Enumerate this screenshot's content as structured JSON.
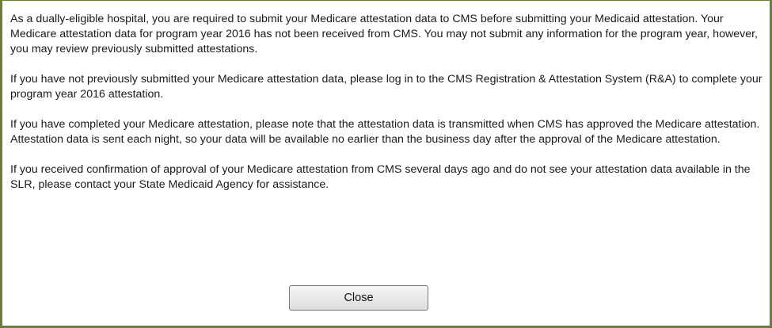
{
  "dialog": {
    "paragraphs": [
      "As a dually-eligible hospital, you are required to submit your Medicare attestation data to CMS before submitting your Medicaid attestation. Your Medicare attestation data for program year 2016 has not been received from CMS. You may not submit any information for the program year, however, you may review previously submitted attestations.",
      "If you have not previously submitted your Medicare attestation data, please log in to the CMS Registration & Attestation System (R&A) to complete your program year 2016 attestation.",
      "If you have completed your Medicare attestation, please note that the attestation data is transmitted when CMS has approved the Medicare attestation. Attestation data is sent each night, so your data will be available no earlier than the business day after the approval of the Medicare attestation.",
      "If you received confirmation of approval of your Medicare attestation from CMS several days ago and do not see your attestation data available in the SLR, please contact your State Medicaid Agency for assistance."
    ],
    "close_label": "Close",
    "border_color": "#6b7c3f"
  }
}
